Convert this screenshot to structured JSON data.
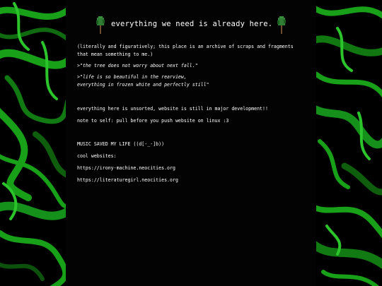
{
  "header": {
    "title": "everything we need is already here."
  },
  "main": {
    "intro": "(literally and figuratively; this place is an archive of scraps and fragments\nthat mean something to me.)",
    "quote1": ">\"the tree does not worry about next fall.\"",
    "quote2": ">\"life is so beautiful in the rearview,\neverything in frozen white and perfectly still\"",
    "notice": "everything here is unsorted, website is still in major development!!",
    "note": "note to self: pull before you push website on linux :3",
    "music": "MUSIC SAVED MY LIFE ((d[-_-]b))",
    "cool_label": "cool websites:",
    "links": [
      "https://irony-machine.neocities.org",
      "https://literaturegirl.neocities.org"
    ]
  },
  "colors": {
    "background": "#000000",
    "panel": "#030303",
    "text": "#ffffff",
    "swirl_green": "#1a9a1a",
    "tree_canopy": "#2e7d32",
    "tree_trunk": "#6d4c2f"
  },
  "icons": [
    "tree-icon",
    "tree-icon"
  ]
}
